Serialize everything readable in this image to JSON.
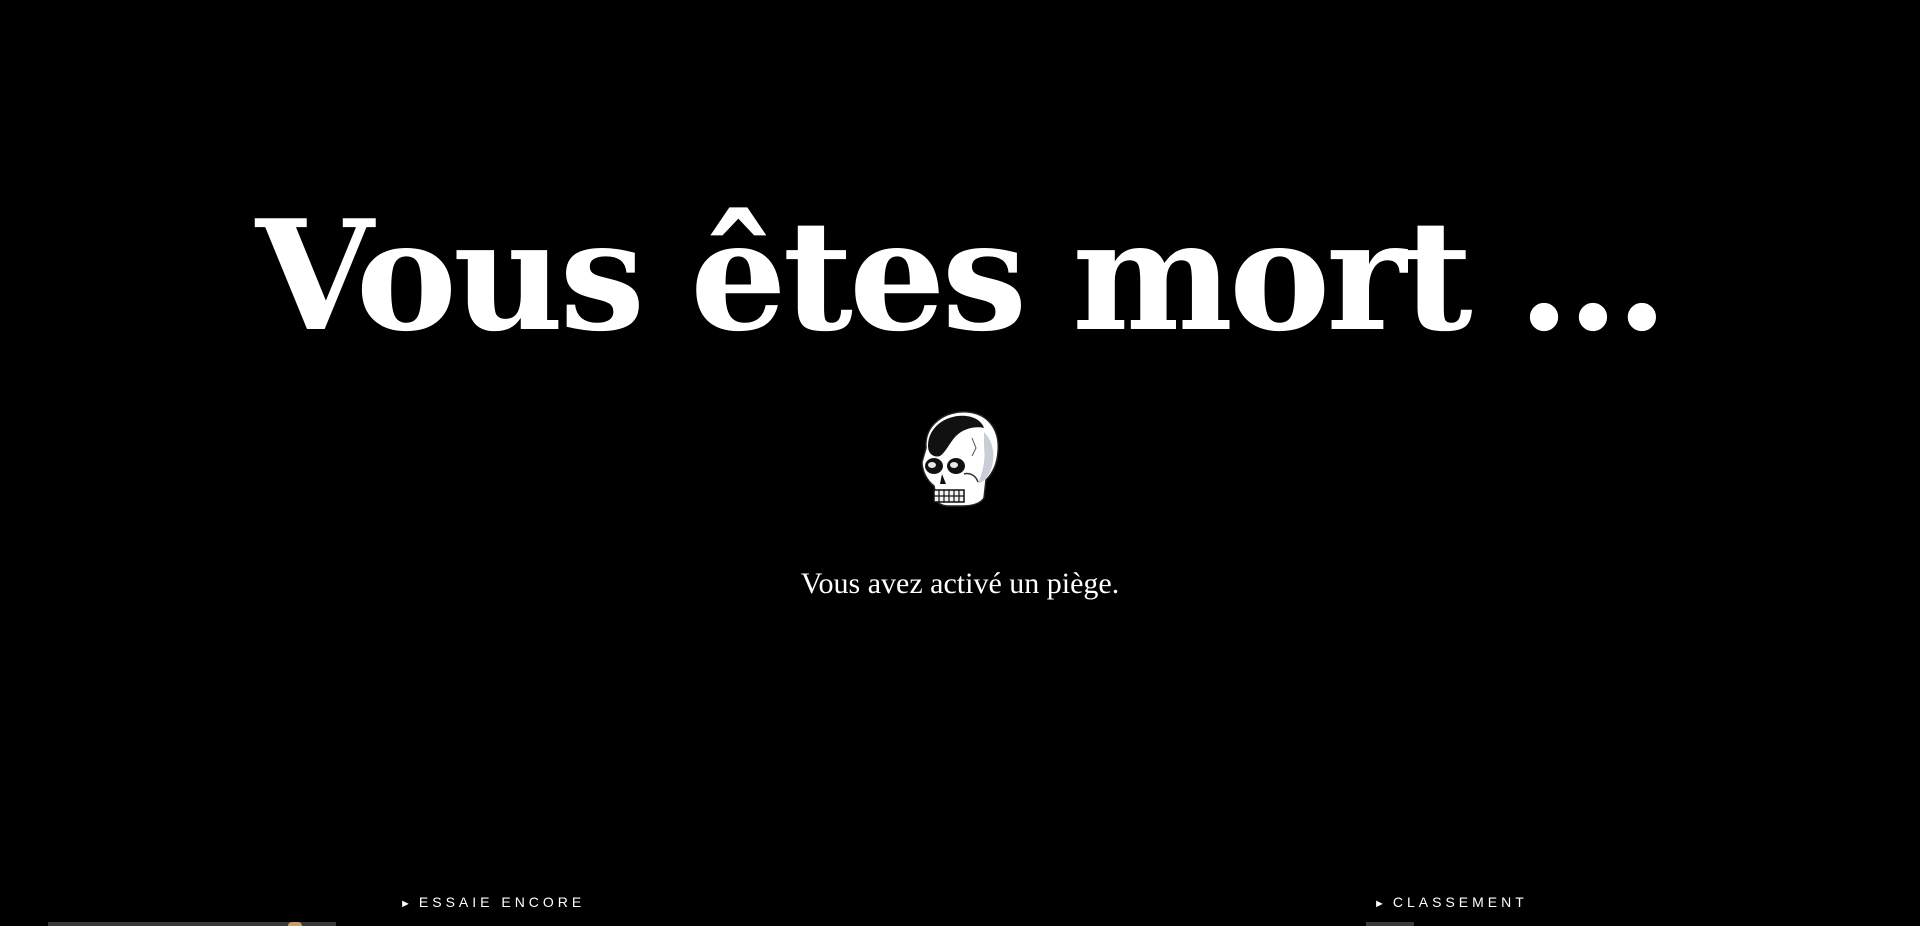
{
  "title": "Vous êtes mort ...",
  "skull_icon": "skull-icon",
  "message": "Vous avez activé un piège.",
  "nav": {
    "arrow": "►",
    "retry_label": "ESSAIE ENCORE",
    "ranking_label": "CLASSEMENT"
  },
  "colors": {
    "background": "#000000",
    "text": "#ffffff"
  }
}
